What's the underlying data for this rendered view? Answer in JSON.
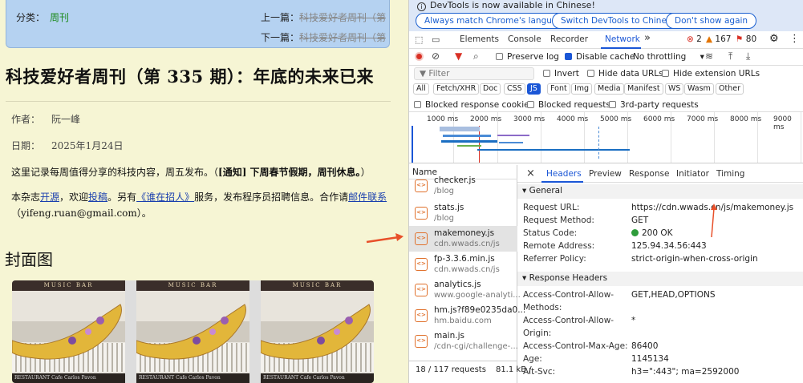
{
  "left": {
    "nav": {
      "category_label": "分类：",
      "category_link": "周刊",
      "prev_label": "上一篇：",
      "prev_link": "科技爱好者周刊（第",
      "next_label": "下一篇：",
      "next_link": "科技爱好者周刊（第"
    },
    "title": "科技爱好者周刊（第 335 期）：年底的未来已来",
    "author_label": "作者：",
    "author": "阮一峰",
    "date_label": "日期：",
    "date": "2025年1月24日",
    "intro_text": "这里记录每周值得分享的科技内容，周五发布。（",
    "intro_bold": "[通知] 下周春节假期，周刊休息。",
    "intro_end": "）",
    "p2": {
      "t1": "本杂志",
      "l1": "开源",
      "t2": "，欢迎",
      "l2": "投稿",
      "t3": "。另有",
      "l3": "《谁在招人》",
      "t4": "服务，发布程序员招聘信息。合作请",
      "l4": "邮件联系",
      "t5": "（yifeng.ruan@gmail.com）。"
    },
    "cover_heading": "封面图",
    "image_band_text": "MUSIC BAR",
    "image_sign_text": "RESTAURANT",
    "image_caption": "Cafe Carlos Pavon"
  },
  "devtools": {
    "info_message": "DevTools is now available in Chinese!",
    "btn_match": "Always match Chrome's language",
    "btn_switch": "Switch DevTools to Chinese",
    "btn_dont": "Don't show again",
    "tabs": [
      "Elements",
      "Console",
      "Recorder",
      "Network"
    ],
    "more_tabs": "»",
    "err_count": "2",
    "warn_count": "167",
    "issue_count": "80",
    "preserve_log": "Preserve log",
    "disable_cache": "Disable cache",
    "throttle": "No throttling",
    "filter_placeholder": "Filter",
    "invert": "Invert",
    "hide_data": "Hide data URLs",
    "hide_ext": "Hide extension URLs",
    "types": [
      "All",
      "Fetch/XHR",
      "Doc",
      "CSS",
      "JS",
      "Font",
      "Img",
      "Media",
      "Manifest",
      "WS",
      "Wasm",
      "Other"
    ],
    "selected_type": "JS",
    "blocked_cookies": "Blocked response cookies",
    "blocked_requests": "Blocked requests",
    "third_party": "3rd-party requests",
    "ticks": [
      "1000 ms",
      "2000 ms",
      "3000 ms",
      "4000 ms",
      "5000 ms",
      "6000 ms",
      "7000 ms",
      "8000 ms",
      "9000 ms"
    ],
    "name_header": "Name",
    "requests": [
      {
        "name": "checker.js",
        "domain": "/blog"
      },
      {
        "name": "stats.js",
        "domain": "/blog"
      },
      {
        "name": "makemoney.js",
        "domain": "cdn.wwads.cn/js"
      },
      {
        "name": "fp-3.3.6.min.js",
        "domain": "cdn.wwads.cn/js"
      },
      {
        "name": "analytics.js",
        "domain": "www.google-analyti..."
      },
      {
        "name": "hm.js?f89e0235da0...",
        "domain": "hm.baidu.com"
      },
      {
        "name": "main.js",
        "domain": "/cdn-cgi/challenge-..."
      }
    ],
    "selected_index": 2,
    "requests_count": "18 / 117 requests",
    "transferred": "81.1 kB /",
    "detail_tabs": [
      "Headers",
      "Preview",
      "Response",
      "Initiator",
      "Timing"
    ],
    "general_label": "General",
    "general": [
      {
        "k": "Request URL:",
        "v": "https://cdn.wwads.cn/js/makemoney.js"
      },
      {
        "k": "Request Method:",
        "v": "GET"
      },
      {
        "k": "Status Code:",
        "v": "200 OK"
      },
      {
        "k": "Remote Address:",
        "v": "125.94.34.56:443"
      },
      {
        "k": "Referrer Policy:",
        "v": "strict-origin-when-cross-origin"
      }
    ],
    "response_headers_label": "Response Headers",
    "resp": [
      {
        "k": "Access-Control-Allow-",
        "k2": "Methods:",
        "v": "GET,HEAD,OPTIONS"
      },
      {
        "k": "Access-Control-Allow-",
        "k2": "Origin:",
        "v": "*"
      },
      {
        "k": "Access-Control-Max-Age:",
        "v": "86400"
      },
      {
        "k": "Age:",
        "v": "1145134"
      },
      {
        "k": "Alt-Svc:",
        "v": "h3=\":443\"; ma=2592000"
      }
    ],
    "colors": {
      "accent": "#1a56d6",
      "file_icon": "#e0712c",
      "ok": "#2e9c3b",
      "annot": "#e8502a"
    }
  }
}
